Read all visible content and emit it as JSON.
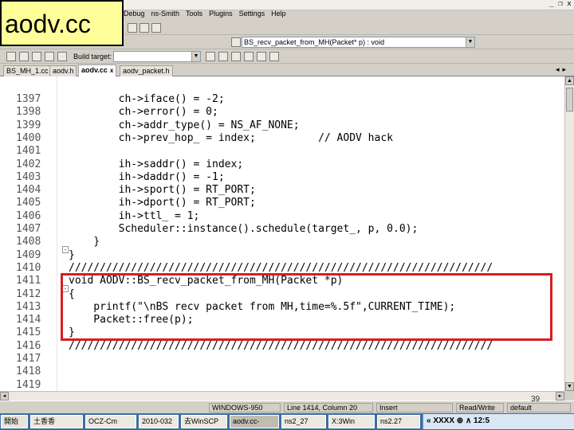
{
  "caption": "aodv.cc",
  "window": {
    "minimize": "_",
    "restore": "❐",
    "close": "x"
  },
  "menubar": [
    "Debug",
    "ns-Smith",
    "Tools",
    "Plugins",
    "Settings",
    "Help"
  ],
  "toolbar": {
    "function_combo": "BS_recv_packet_from_MH(Packet* p) : void",
    "build_label": "Build target:",
    "build_target_combo": ""
  },
  "tabs": [
    {
      "label": "BS_MH_1.cc",
      "active": false
    },
    {
      "label": "aodv.h",
      "active": false
    },
    {
      "label": "aodv.cc",
      "active": true
    },
    {
      "label": "aodv_packet.h",
      "active": false
    }
  ],
  "tab_nav": [
    "◂",
    "▸"
  ],
  "code_lines": [
    {
      "n": "1397",
      "text": "        ch->iface() = -2;"
    },
    {
      "n": "1398",
      "text": "        ch->error() = 0;"
    },
    {
      "n": "1399",
      "text": "        ch->addr_type() = NS_AF_NONE;"
    },
    {
      "n": "1400",
      "text": "        ch->prev_hop_ = index;          // AODV hack"
    },
    {
      "n": "1401",
      "text": ""
    },
    {
      "n": "1402",
      "text": "        ih->saddr() = index;"
    },
    {
      "n": "1403",
      "text": "        ih->daddr() = -1;"
    },
    {
      "n": "1404",
      "text": "        ih->sport() = RT_PORT;"
    },
    {
      "n": "1405",
      "text": "        ih->dport() = RT_PORT;"
    },
    {
      "n": "1406",
      "text": "        ih->ttl_ = 1;"
    },
    {
      "n": "1407",
      "text": "        Scheduler::instance().schedule(target_, p, 0.0);"
    },
    {
      "n": "1408",
      "text": "    }"
    },
    {
      "n": "1409",
      "text": "}"
    },
    {
      "n": "1410",
      "text": "////////////////////////////////////////////////////////////////////"
    },
    {
      "n": "1411",
      "text": "void AODV::BS_recv_packet_from_MH(Packet *p)"
    },
    {
      "n": "1412",
      "text": "{"
    },
    {
      "n": "1413",
      "text": "    printf(\"\\nBS recv packet from MH,time=%.5f\",CURRENT_TIME);"
    },
    {
      "n": "1414",
      "text": "    Packet::free(p);"
    },
    {
      "n": "1415",
      "text": "}"
    },
    {
      "n": "1416",
      "text": "////////////////////////////////////////////////////////////////////"
    },
    {
      "n": "1417",
      "text": ""
    },
    {
      "n": "1418",
      "text": ""
    },
    {
      "n": "1419",
      "text": ""
    }
  ],
  "page_number": "39",
  "statusbar": {
    "encoding": "WINDOWS-950",
    "position": "Line 1414, Column 20",
    "mode": "Insert",
    "access": "Read/Write",
    "extra": "default"
  },
  "taskbar": {
    "start": "開始",
    "items": [
      "土香香",
      "OCZ-Cm",
      "2010-032",
      "去WinSCP",
      "aodv.cc-",
      "ns2_27",
      "X:3Win",
      "ns2.27"
    ],
    "tray": "« XXXX ⊕ ∧ 12:5"
  }
}
